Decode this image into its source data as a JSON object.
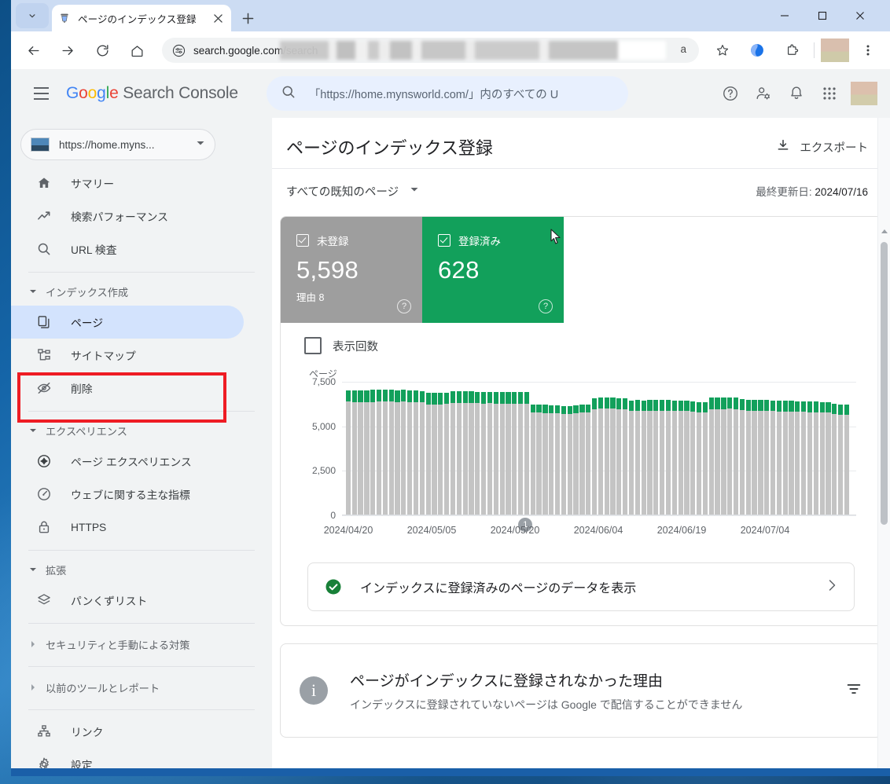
{
  "browser": {
    "tab": {
      "title": "ページのインデックス登録",
      "favicon": "search-console-favicon"
    },
    "new_tab_label": "+",
    "omnibox": {
      "url_visible": "search.google.com/search",
      "url_tail": "a",
      "redacted": true
    },
    "window_controls": {
      "minimize": "–",
      "maximize": "□",
      "close": "✕"
    }
  },
  "gsc_header": {
    "brand": {
      "g1": "G",
      "o1": "o",
      "o2": "o",
      "g2": "g",
      "l": "l",
      "e": "e",
      "suffix": "Search Console"
    },
    "search_placeholder": "「https://home.mynsworld.com/」内のすべての U",
    "icons": [
      "help-icon",
      "account-settings-icon",
      "notifications-bell-icon",
      "google-apps-grid-icon",
      "user-avatar"
    ]
  },
  "sidebar": {
    "property": {
      "label": "https://home.myns...",
      "caret": "▼"
    },
    "groups": [
      {
        "type": "plain",
        "items": [
          {
            "label": "サマリー",
            "icon": "home-icon",
            "selected": false
          },
          {
            "label": "検索パフォーマンス",
            "icon": "trending-up-icon",
            "selected": false
          },
          {
            "label": "URL 検査",
            "icon": "search-icon",
            "selected": false
          }
        ]
      },
      {
        "type": "section",
        "title": "インデックス作成",
        "expanded": true,
        "items": [
          {
            "label": "ページ",
            "icon": "pages-copy-icon",
            "selected": true
          },
          {
            "label": "サイトマップ",
            "icon": "sitemap-icon",
            "selected": false
          },
          {
            "label": "削除",
            "icon": "eye-off-icon",
            "selected": false
          }
        ]
      },
      {
        "type": "section",
        "title": "エクスペリエンス",
        "expanded": true,
        "items": [
          {
            "label": "ページ エクスペリエンス",
            "icon": "page-experience-icon",
            "selected": false
          },
          {
            "label": "ウェブに関する主な指標",
            "icon": "core-web-vitals-icon",
            "selected": false
          },
          {
            "label": "HTTPS",
            "icon": "lock-icon",
            "selected": false
          }
        ]
      },
      {
        "type": "section",
        "title": "拡張",
        "expanded": true,
        "items": [
          {
            "label": "パンくずリスト",
            "icon": "layers-icon",
            "selected": false
          }
        ]
      },
      {
        "type": "collapsed",
        "title": "セキュリティと手動による対策",
        "expanded": false
      },
      {
        "type": "collapsed",
        "title": "以前のツールとレポート",
        "expanded": false
      },
      {
        "type": "plain",
        "items": [
          {
            "label": "リンク",
            "icon": "links-hierarchy-icon",
            "selected": false
          },
          {
            "label": "設定",
            "icon": "gear-icon",
            "selected": false
          }
        ]
      }
    ],
    "highlight_annotation": {
      "target": "ページ",
      "color": "#ee1c24"
    }
  },
  "main": {
    "page_title": "ページのインデックス登録",
    "export_label": "エクスポート",
    "filter_label": "すべての既知のページ",
    "filter_caret": "▼",
    "last_updated_label": "最終更新日:",
    "last_updated_value": "2024/07/16",
    "metrics": [
      {
        "label": "未登録",
        "value": "5,598",
        "sub": "理由 8",
        "color": "#9e9e9e",
        "checked": true,
        "help": "?"
      },
      {
        "label": "登録済み",
        "value": "628",
        "sub": "",
        "color": "#12a05b",
        "checked": true,
        "help": "?"
      }
    ],
    "impressions_toggle": {
      "label": "表示回数",
      "checked": false
    },
    "banner": {
      "text": "インデックスに登録済みのページのデータを表示",
      "icon": "check-circle-icon",
      "chevron": "›"
    },
    "reasons": {
      "title": "ページがインデックスに登録されなかった理由",
      "subtitle": "インデックスに登録されていないページは Google で配信することができません",
      "info_icon": "info-icon",
      "filter_icon": "filter-icon"
    }
  },
  "chart_data": {
    "type": "bar",
    "stacked": true,
    "title": "",
    "ylabel": "ページ",
    "xlabel": "",
    "ylim": [
      0,
      7500
    ],
    "yticks": [
      0,
      2500,
      5000,
      7500
    ],
    "ytick_labels": [
      "0",
      "2,500",
      "5,000",
      "7,500"
    ],
    "grid": true,
    "legend_position": "top-left",
    "xtick_labels": [
      "2024/04/20",
      "2024/05/05",
      "2024/05/20",
      "2024/06/04",
      "2024/06/19",
      "2024/07/04"
    ],
    "annotations": [
      {
        "label": "1",
        "x_index": 34
      }
    ],
    "series": [
      {
        "name": "未登録",
        "color": "#c4c4c4",
        "values": [
          6380,
          6370,
          6365,
          6370,
          6375,
          6395,
          6400,
          6390,
          6370,
          6380,
          6365,
          6375,
          6340,
          6230,
          6230,
          6235,
          6250,
          6300,
          6310,
          6300,
          6295,
          6290,
          6280,
          6290,
          6280,
          6270,
          6265,
          6270,
          6275,
          6270,
          5780,
          5760,
          5755,
          5750,
          5720,
          5700,
          5710,
          5725,
          5760,
          5780,
          5950,
          5985,
          5990,
          5985,
          5960,
          5935,
          5870,
          5880,
          5875,
          5880,
          5885,
          5890,
          5885,
          5880,
          5875,
          5870,
          5830,
          5790,
          5800,
          5960,
          5970,
          5975,
          5980,
          5970,
          5900,
          5880,
          5870,
          5865,
          5860,
          5850,
          5845,
          5840,
          5835,
          5820,
          5810,
          5800,
          5790,
          5780,
          5760,
          5700,
          5660,
          5650
        ]
      },
      {
        "name": "登録済み",
        "color": "#12a05b",
        "values": [
          650,
          655,
          660,
          660,
          665,
          670,
          670,
          665,
          665,
          660,
          655,
          660,
          650,
          640,
          645,
          650,
          655,
          660,
          660,
          655,
          655,
          650,
          650,
          650,
          645,
          645,
          645,
          645,
          650,
          650,
          440,
          440,
          445,
          440,
          440,
          435,
          440,
          440,
          450,
          450,
          620,
          625,
          630,
          630,
          625,
          620,
          580,
          585,
          585,
          585,
          585,
          585,
          585,
          580,
          580,
          575,
          560,
          545,
          550,
          640,
          645,
          645,
          650,
          645,
          620,
          615,
          610,
          610,
          605,
          605,
          600,
          600,
          600,
          595,
          595,
          590,
          590,
          585,
          580,
          575,
          570,
          570
        ]
      }
    ]
  }
}
